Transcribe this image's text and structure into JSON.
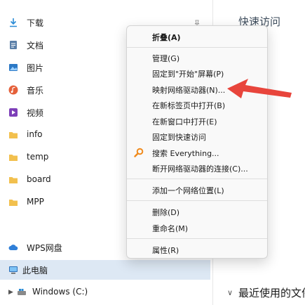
{
  "nav": {
    "items": [
      {
        "label": "下载",
        "icon": "download-icon"
      },
      {
        "label": "文档",
        "icon": "document-icon"
      },
      {
        "label": "图片",
        "icon": "picture-icon"
      },
      {
        "label": "音乐",
        "icon": "music-icon"
      },
      {
        "label": "视频",
        "icon": "video-icon"
      },
      {
        "label": "info",
        "icon": "folder-icon"
      },
      {
        "label": "temp",
        "icon": "folder-icon"
      },
      {
        "label": "board",
        "icon": "folder-icon"
      },
      {
        "label": "MPP",
        "icon": "folder-icon"
      },
      {
        "label": "WPS网盘",
        "icon": "cloud-icon"
      },
      {
        "label": "此电脑",
        "icon": "computer-icon"
      },
      {
        "label": "Windows  (C:)",
        "icon": "drive-icon"
      }
    ],
    "selected": "此电脑"
  },
  "right": {
    "header": "快速访问",
    "footer": "最近使用的文件"
  },
  "context_menu": {
    "items": [
      {
        "label": "折叠(A)",
        "bold": true
      },
      {
        "label": "管理(G)"
      },
      {
        "label": "固定到\"开始\"屏幕(P)"
      },
      {
        "label": "映射网络驱动器(N)..."
      },
      {
        "label": "在新标签页中打开(B)"
      },
      {
        "label": "在新窗口中打开(E)"
      },
      {
        "label": "固定到快速访问"
      },
      {
        "label": "搜索 Everything...",
        "icon": "everything-search-icon"
      },
      {
        "label": "断开网络驱动器的连接(C)..."
      },
      {
        "label": "添加一个网络位置(L)"
      },
      {
        "label": "删除(D)"
      },
      {
        "label": "重命名(M)"
      },
      {
        "label": "属性(R)"
      }
    ]
  },
  "colors": {
    "selected_bg": "#dde8f4",
    "arrow": "#e8453c",
    "folder": "#f2c04e"
  }
}
